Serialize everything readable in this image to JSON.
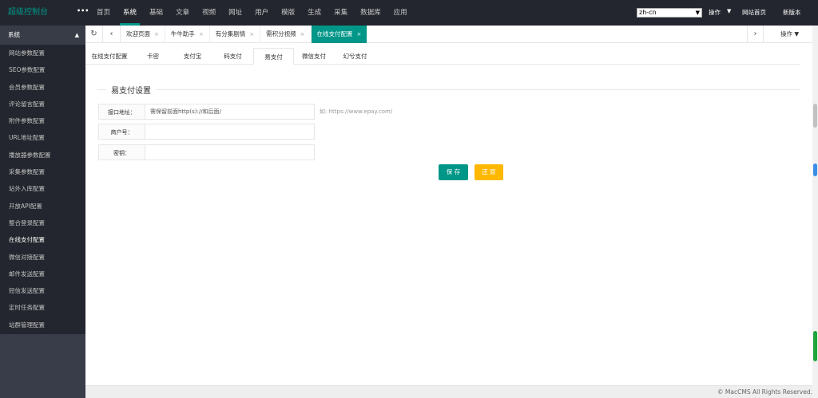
{
  "app": {
    "title": "超级控制台",
    "toggle": "•••"
  },
  "topnav": [
    "首页",
    "系统",
    "基础",
    "文章",
    "视频",
    "网址",
    "用户",
    "模版",
    "生成",
    "采集",
    "数据库",
    "应用"
  ],
  "topnav_active": "系统",
  "lang": {
    "value": "zh-cn"
  },
  "top_actions": {
    "operate": "操作",
    "site_home": "网站首页",
    "new_version": "新版本"
  },
  "sidebar": {
    "heading": "系统",
    "items": [
      "网站参数配置",
      "SEO参数配置",
      "会员参数配置",
      "评论留言配置",
      "附件参数配置",
      "URL地址配置",
      "播放器参数配置",
      "采集参数配置",
      "站外入库配置",
      "开放API配置",
      "整合登录配置",
      "在线支付配置",
      "微信对接配置",
      "邮件发送配置",
      "短信发送配置",
      "定时任务配置",
      "站群管理配置"
    ],
    "active": "在线支付配置"
  },
  "tabs": {
    "items": [
      "欢迎页面",
      "牛牛助手",
      "有分集剧情",
      "需积分视频",
      "在线支付配置"
    ],
    "active": "在线支付配置",
    "close_glyph": "×",
    "operate": "操作"
  },
  "subtabs": {
    "items": [
      "在线支付配置",
      "卡密",
      "支付宝",
      "码支付",
      "易支付",
      "微信支付",
      "幻兮支付"
    ],
    "active": "易支付"
  },
  "form": {
    "legend": "易支付设置",
    "api_label": "接口地址：",
    "api_placeholder": "需保留前面http(s)://和后面/",
    "api_hint": "如: https://www.epay.com/",
    "merchant_label": "商户号：",
    "merchant_value": "",
    "key_label": "密钥：",
    "key_value": "",
    "save": "保 存",
    "reset": "还 原"
  },
  "footer": {
    "copyright": "© MacCMS All Rights Reserved."
  },
  "colors": {
    "accent": "#009688",
    "warn": "#ffb800",
    "topbar": "#23262e"
  }
}
